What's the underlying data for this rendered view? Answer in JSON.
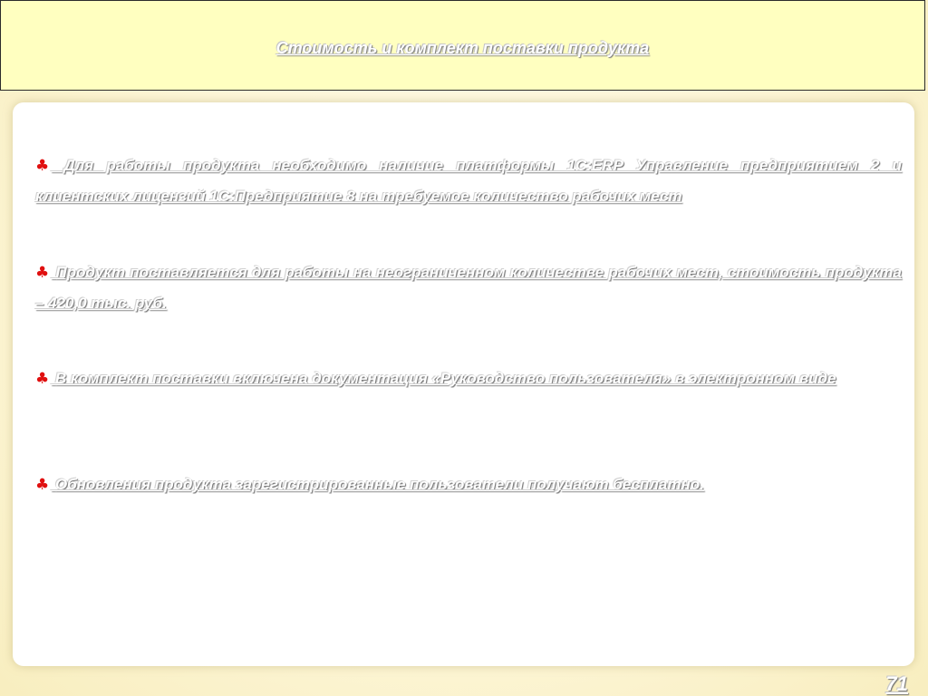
{
  "slide": {
    "title": "Стоимость и комплект поставки продукта",
    "page_number": "71",
    "bullet_icon": "club-icon",
    "bullet_icon_color": "#e01010",
    "bullets": [
      {
        "text": "Для работы продукта необходимо наличие платформы 1С:ERP Управление предприятием 2 и клиентских лицензий 1С:Предприятие 8 на требуемое количество рабочих мест"
      },
      {
        "text": "Продукт поставляется для работы на неограниченном количестве рабочих мест, стоимость продукта – 420,0 тыс. руб."
      },
      {
        "text": "В комплект поставки включена документация «Руководство пользователя» в электронном виде"
      },
      {
        "text": "Обновления продукта зарегистрированные пользователи получают бесплатно."
      }
    ]
  }
}
